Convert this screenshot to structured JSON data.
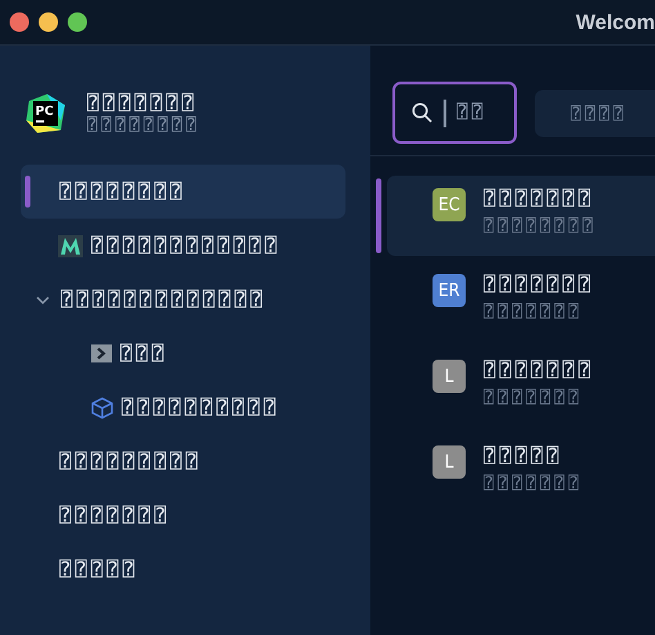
{
  "window": {
    "title": "Welcom"
  },
  "sidebar": {
    "logo_text": "PC",
    "app_name": "⍰⍰⍰⍰⍰⍰⍰",
    "app_subtitle": "⍰⍰⍰⍰⍰⍰⍰⍰",
    "items": [
      {
        "kind": "nav",
        "label": "⍰⍰⍰⍰⍰⍰⍰⍰",
        "selected": true
      },
      {
        "kind": "plugin",
        "label": "⍰⍰⍰⍰⍰⍰⍰⍰⍰⍰⍰⍰",
        "selected": false
      },
      {
        "kind": "group",
        "label": "⍰⍰⍰⍰⍰⍰⍰⍰⍰⍰⍰⍰⍰",
        "selected": false,
        "expanded": true,
        "children": [
          {
            "kind": "terminal",
            "label": "⍰⍰⍰",
            "selected": false
          },
          {
            "kind": "package",
            "label": "⍰⍰⍰⍰⍰⍰⍰⍰⍰⍰",
            "selected": false
          }
        ]
      },
      {
        "kind": "nav",
        "label": "⍰⍰⍰⍰⍰⍰⍰⍰⍰",
        "selected": false
      },
      {
        "kind": "nav",
        "label": "⍰⍰⍰⍰⍰⍰⍰",
        "selected": false
      },
      {
        "kind": "nav",
        "label": "⍰⍰⍰⍰⍰",
        "selected": false
      }
    ]
  },
  "main": {
    "search": {
      "value": "⍰⍰"
    },
    "button": {
      "label": "⍰⍰⍰⍰"
    },
    "projects": [
      {
        "badge": "EC",
        "color": "#8fa552",
        "title": "⍰⍰⍰⍰⍰⍰⍰",
        "path": "⍰⍰⍰⍰⍰⍰⍰⍰",
        "selected": true
      },
      {
        "badge": "ER",
        "color": "#4f7fd1",
        "title": "⍰⍰⍰⍰⍰⍰⍰",
        "path": "⍰⍰⍰⍰⍰⍰⍰",
        "selected": false
      },
      {
        "badge": "L",
        "color": "#8c8c8c",
        "title": "⍰⍰⍰⍰⍰⍰⍰",
        "path": "⍰⍰⍰⍰⍰⍰⍰",
        "selected": false
      },
      {
        "badge": "L",
        "color": "#8c8c8c",
        "title": "⍰⍰⍰⍰⍰",
        "path": "⍰⍰⍰⍰⍰⍰⍰",
        "selected": false
      }
    ]
  }
}
